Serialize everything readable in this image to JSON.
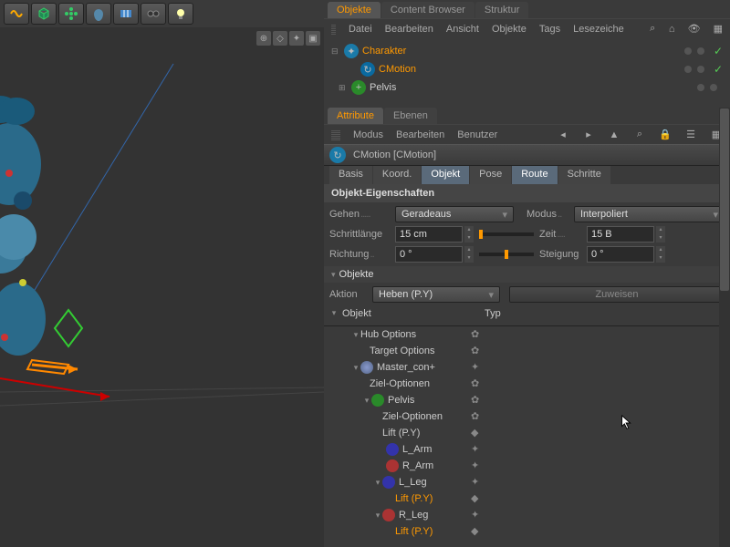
{
  "tabs_top": {
    "objekte": "Objekte",
    "content": "Content Browser",
    "struktur": "Struktur"
  },
  "menu_obj": [
    "Datei",
    "Bearbeiten",
    "Ansicht",
    "Objekte",
    "Tags",
    "Lesezeiche"
  ],
  "hierarchy": {
    "charakter": "Charakter",
    "cmotion": "CMotion",
    "pelvis": "Pelvis"
  },
  "attr_tabs": {
    "attribute": "Attribute",
    "ebenen": "Ebenen"
  },
  "attr_menu": [
    "Modus",
    "Bearbeiten",
    "Benutzer"
  ],
  "obj_title": "CMotion [CMotion]",
  "sub_tabs": {
    "basis": "Basis",
    "koord": "Koord.",
    "objekt": "Objekt",
    "pose": "Pose",
    "route": "Route",
    "schritte": "Schritte"
  },
  "section": "Objekt-Eigenschaften",
  "props": {
    "gehen_label": "Gehen",
    "gehen_val": "Geradeaus",
    "modus_label": "Modus",
    "modus_val": "Interpoliert",
    "schrittlaenge_label": "Schrittlänge",
    "schrittlaenge_val": "15 cm",
    "zeit_label": "Zeit",
    "zeit_val": "15 B",
    "richtung_label": "Richtung",
    "richtung_val": "0 °",
    "steigung_label": "Steigung",
    "steigung_val": "0 °"
  },
  "objekte_label": "Objekte",
  "aktion_label": "Aktion",
  "aktion_val": "Heben (P.Y)",
  "zuweisen": "Zuweisen",
  "table": {
    "objekt": "Objekt",
    "typ": "Typ"
  },
  "tree": {
    "hub": "Hub Options",
    "target": "Target Options",
    "master": "Master_con+",
    "ziel": "Ziel-Optionen",
    "pelvis": "Pelvis",
    "ziel2": "Ziel-Optionen",
    "lift": "Lift (P.Y)",
    "larm": "L_Arm",
    "rarm": "R_Arm",
    "lleg": "L_Leg",
    "liftpy": "Lift (P.Y)",
    "rleg": "R_Leg",
    "liftpy2": "Lift (P.Y)"
  }
}
